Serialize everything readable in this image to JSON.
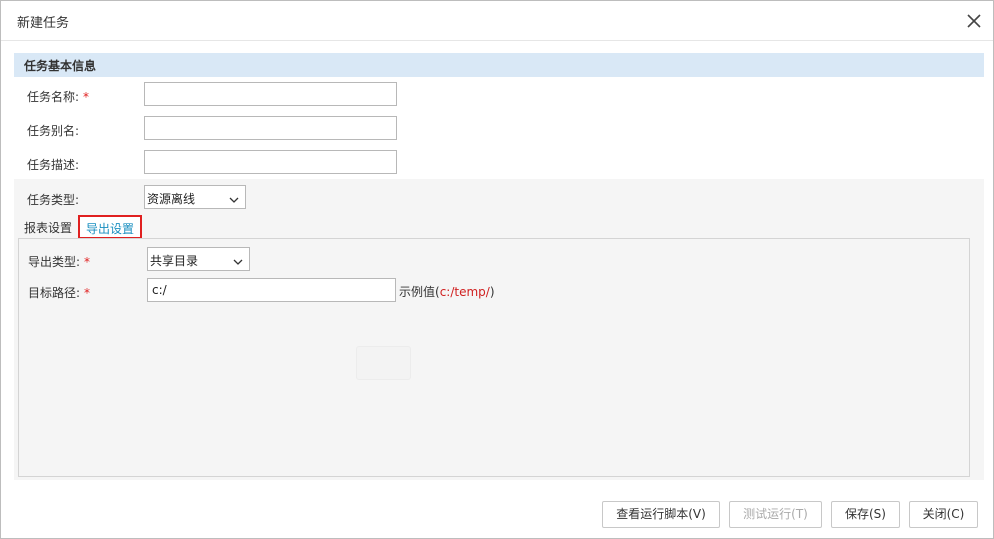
{
  "dialog": {
    "title": "新建任务",
    "close_icon": "close-icon"
  },
  "section": {
    "title": "任务基本信息"
  },
  "form": {
    "task_name": {
      "label": "任务名称:",
      "required": "*",
      "value": ""
    },
    "task_alias": {
      "label": "任务别名:",
      "value": ""
    },
    "task_desc": {
      "label": "任务描述:",
      "value": ""
    },
    "task_type": {
      "label": "任务类型:",
      "selected": "资源离线"
    }
  },
  "tabs": [
    {
      "label": "报表设置",
      "active": false
    },
    {
      "label": "导出设置",
      "active": true
    }
  ],
  "export": {
    "export_type": {
      "label": "导出类型:",
      "required": "*",
      "selected": "共享目录"
    },
    "target_path": {
      "label": "目标路径:",
      "required": "*",
      "value": "c:/"
    },
    "hint_prefix": "示例值(",
    "hint_example": "c:/temp/",
    "hint_suffix": ")"
  },
  "buttons": {
    "view_script": "查看运行脚本(V)",
    "test_run": "测试运行(T)",
    "save": "保存(S)",
    "close": "关闭(C)"
  },
  "colors": {
    "header_bg": "#d9e8f6",
    "required": "#e02020",
    "active_tab_text": "#1a8fc0",
    "active_tab_border": "#e02020"
  }
}
